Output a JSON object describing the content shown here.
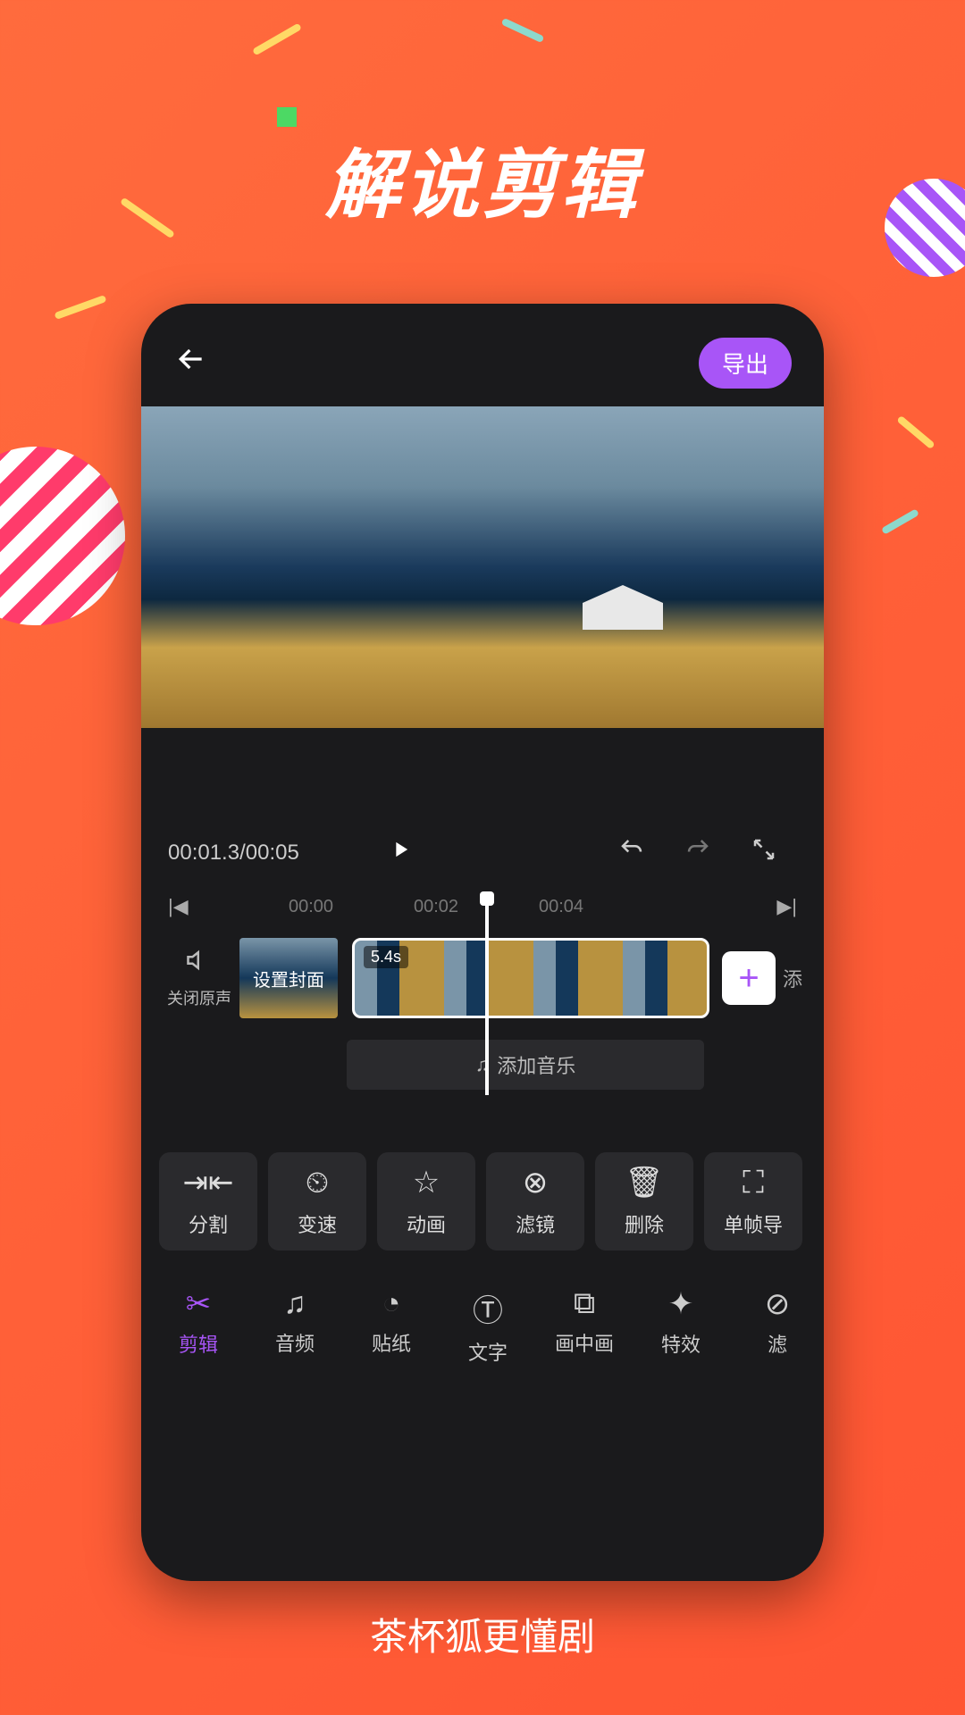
{
  "headline": "解说剪辑",
  "footer": "茶杯狐更懂剧",
  "topbar": {
    "export": "导出"
  },
  "controls": {
    "time_current": "00:01.3",
    "time_total": "00:05"
  },
  "ruler": {
    "t0": "00:00",
    "t1": "00:02",
    "t2": "00:04"
  },
  "timeline": {
    "mute_label": "关闭原声",
    "cover_label": "设置封面",
    "clip_duration": "5.4s",
    "add_label": "添",
    "music_label": "添加音乐"
  },
  "tools": [
    {
      "icon": "⇥⇤",
      "label": "分割"
    },
    {
      "icon": "⏲",
      "label": "变速"
    },
    {
      "icon": "☆",
      "label": "动画"
    },
    {
      "icon": "⊗",
      "label": "滤镜"
    },
    {
      "icon": "🗑",
      "label": "删除"
    },
    {
      "icon": "⛶",
      "label": "单帧导"
    }
  ],
  "tabs": [
    {
      "icon": "✂",
      "label": "剪辑",
      "active": true
    },
    {
      "icon": "♫",
      "label": "音频"
    },
    {
      "icon": "◔",
      "label": "贴纸"
    },
    {
      "icon": "Ⓣ",
      "label": "文字"
    },
    {
      "icon": "⧉",
      "label": "画中画"
    },
    {
      "icon": "✦",
      "label": "特效"
    },
    {
      "icon": "⊘",
      "label": "滤"
    }
  ]
}
